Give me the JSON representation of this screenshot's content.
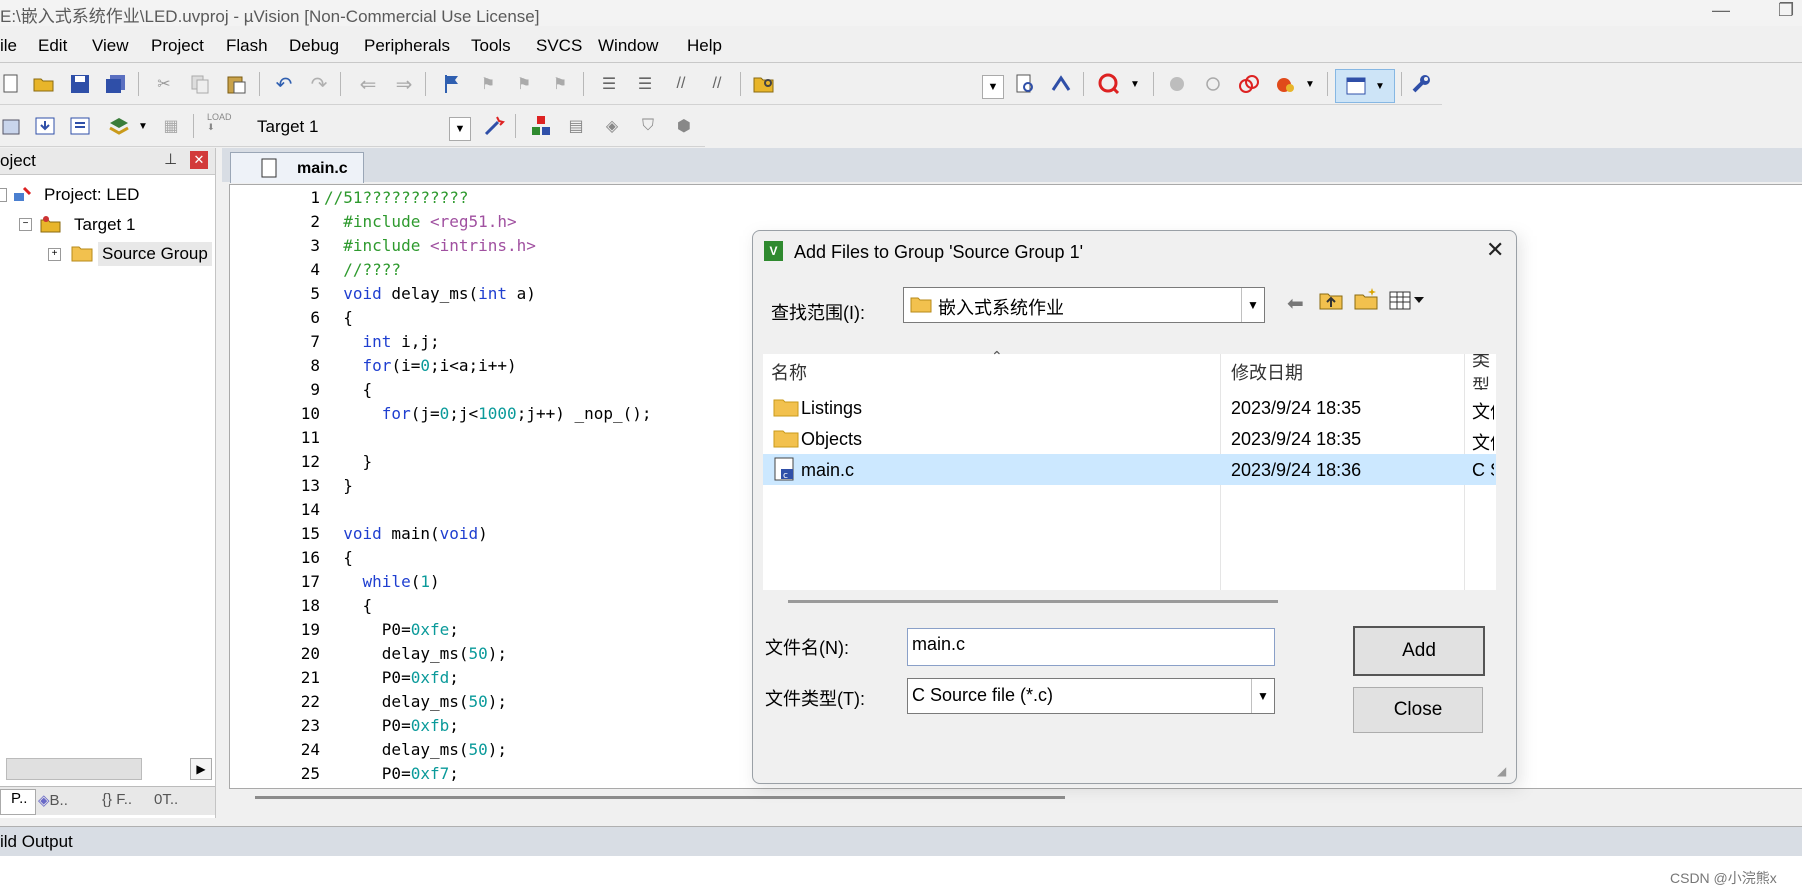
{
  "window": {
    "title": "E:\\嵌入式系统作业\\LED.uvproj - µVision  [Non-Commercial Use License]",
    "minimize_glyph": "—",
    "restore_glyph": "❐"
  },
  "menu": [
    "ile",
    "Edit",
    "View",
    "Project",
    "Flash",
    "Debug",
    "Peripherals",
    "Tools",
    "SVCS",
    "Window",
    "Help"
  ],
  "toolbar2": {
    "target_select": "Target 1",
    "load_label": "LOAD"
  },
  "project_panel": {
    "title": "oject",
    "tree": [
      "Project: LED",
      "Target 1",
      "Source Group"
    ],
    "bottom_tabs": [
      "P..",
      "B..",
      "F..",
      "T.."
    ]
  },
  "editor": {
    "active_tab": "main.c",
    "lines": [
      {
        "n": "1",
        "text": "//51???????????"
      },
      {
        "n": "2",
        "text": "  #include <reg51.h>"
      },
      {
        "n": "3",
        "text": "  #include <intrins.h>"
      },
      {
        "n": "4",
        "text": "  //????"
      },
      {
        "n": "5",
        "text": "  void delay_ms(int a)"
      },
      {
        "n": "6",
        "text": "  {"
      },
      {
        "n": "7",
        "text": "    int i,j;"
      },
      {
        "n": "8",
        "text": "    for(i=0;i<a;i++)"
      },
      {
        "n": "9",
        "text": "    {"
      },
      {
        "n": "10",
        "text": "      for(j=0;j<1000;j++) _nop_();"
      },
      {
        "n": "11",
        "text": ""
      },
      {
        "n": "12",
        "text": "    }"
      },
      {
        "n": "13",
        "text": "  }"
      },
      {
        "n": "14",
        "text": ""
      },
      {
        "n": "15",
        "text": "  void main(void)"
      },
      {
        "n": "16",
        "text": "  {"
      },
      {
        "n": "17",
        "text": "    while(1)"
      },
      {
        "n": "18",
        "text": "    {"
      },
      {
        "n": "19",
        "text": "      P0=0xfe;"
      },
      {
        "n": "20",
        "text": "      delay_ms(50);"
      },
      {
        "n": "21",
        "text": "      P0=0xfd;"
      },
      {
        "n": "22",
        "text": "      delay_ms(50);"
      },
      {
        "n": "23",
        "text": "      P0=0xfb;"
      },
      {
        "n": "24",
        "text": "      delay_ms(50);"
      },
      {
        "n": "25",
        "text": "      P0=0xf7;"
      }
    ]
  },
  "dialog": {
    "title": "Add Files to Group 'Source Group 1'",
    "look_in_label": "查找范围(I):",
    "look_in_value": "嵌入式系统作业",
    "columns": [
      "名称",
      "修改日期",
      "类型"
    ],
    "files": [
      {
        "name": "Listings",
        "date": "2023/9/24 18:35",
        "type": "文件夹",
        "kind": "folder"
      },
      {
        "name": "Objects",
        "date": "2023/9/24 18:35",
        "type": "文件夹",
        "kind": "folder"
      },
      {
        "name": "main.c",
        "date": "2023/9/24 18:36",
        "type": "C Source",
        "kind": "c-file"
      }
    ],
    "filename_label": "文件名(N):",
    "filename_value": "main.c",
    "filetype_label": "文件类型(T):",
    "filetype_value": "C Source file (*.c)",
    "add_button": "Add",
    "close_button": "Close"
  },
  "build_output": {
    "title": "ild Output"
  },
  "watermark": "CSDN @小浣熊x"
}
